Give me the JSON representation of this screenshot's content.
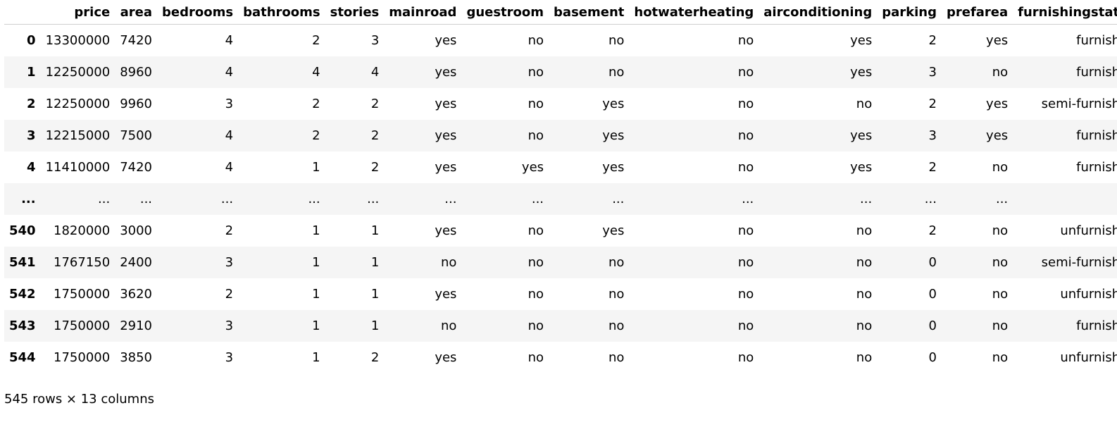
{
  "dataframe": {
    "columns": [
      "",
      "price",
      "area",
      "bedrooms",
      "bathrooms",
      "stories",
      "mainroad",
      "guestroom",
      "basement",
      "hotwaterheating",
      "airconditioning",
      "parking",
      "prefarea",
      "furnishingstatus"
    ],
    "rows": [
      [
        "0",
        "13300000",
        "7420",
        "4",
        "2",
        "3",
        "yes",
        "no",
        "no",
        "no",
        "yes",
        "2",
        "yes",
        "furnished"
      ],
      [
        "1",
        "12250000",
        "8960",
        "4",
        "4",
        "4",
        "yes",
        "no",
        "no",
        "no",
        "yes",
        "3",
        "no",
        "furnished"
      ],
      [
        "2",
        "12250000",
        "9960",
        "3",
        "2",
        "2",
        "yes",
        "no",
        "yes",
        "no",
        "no",
        "2",
        "yes",
        "semi-furnished"
      ],
      [
        "3",
        "12215000",
        "7500",
        "4",
        "2",
        "2",
        "yes",
        "no",
        "yes",
        "no",
        "yes",
        "3",
        "yes",
        "furnished"
      ],
      [
        "4",
        "11410000",
        "7420",
        "4",
        "1",
        "2",
        "yes",
        "yes",
        "yes",
        "no",
        "yes",
        "2",
        "no",
        "furnished"
      ],
      [
        "...",
        "...",
        "...",
        "...",
        "...",
        "...",
        "...",
        "...",
        "...",
        "...",
        "...",
        "...",
        "...",
        "..."
      ],
      [
        "540",
        "1820000",
        "3000",
        "2",
        "1",
        "1",
        "yes",
        "no",
        "yes",
        "no",
        "no",
        "2",
        "no",
        "unfurnished"
      ],
      [
        "541",
        "1767150",
        "2400",
        "3",
        "1",
        "1",
        "no",
        "no",
        "no",
        "no",
        "no",
        "0",
        "no",
        "semi-furnished"
      ],
      [
        "542",
        "1750000",
        "3620",
        "2",
        "1",
        "1",
        "yes",
        "no",
        "no",
        "no",
        "no",
        "0",
        "no",
        "unfurnished"
      ],
      [
        "543",
        "1750000",
        "2910",
        "3",
        "1",
        "1",
        "no",
        "no",
        "no",
        "no",
        "no",
        "0",
        "no",
        "furnished"
      ],
      [
        "544",
        "1750000",
        "3850",
        "3",
        "1",
        "2",
        "yes",
        "no",
        "no",
        "no",
        "no",
        "0",
        "no",
        "unfurnished"
      ]
    ],
    "footer": "545 rows × 13 columns"
  }
}
